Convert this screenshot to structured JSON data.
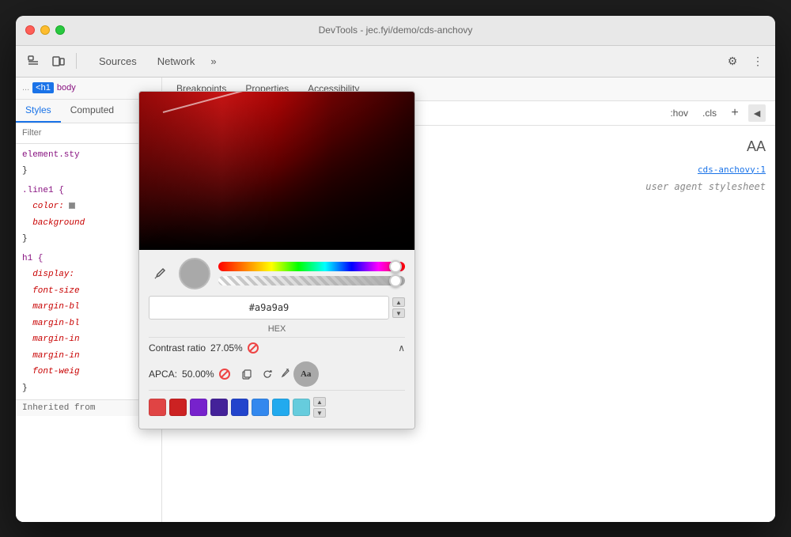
{
  "window": {
    "title": "DevTools - jec.fyi/demo/cds-anchovy",
    "traffic_lights": [
      "close",
      "minimize",
      "maximize"
    ]
  },
  "top_toolbar": {
    "tabs": [
      {
        "label": "Sources",
        "active": false
      },
      {
        "label": "Network",
        "active": false
      }
    ],
    "more_label": "»",
    "settings_icon": "⚙",
    "more_options_icon": "⋮"
  },
  "left_panel": {
    "breadcrumb": {
      "dots": "...",
      "html_tag": "<h1",
      "body_tag": "body"
    },
    "sub_tabs": [
      "Styles",
      "Computed"
    ],
    "filter_placeholder": "Filter",
    "css_rules": [
      {
        "selector": "element.style",
        "brace_open": "{",
        "brace_close": "}"
      },
      {
        "selector": ".line1",
        "brace_open": "{",
        "properties": [
          {
            "name": "color:",
            "value": "",
            "has_swatch": true,
            "swatch_color": "#888"
          },
          {
            "name": "background",
            "value": ""
          }
        ],
        "brace_close": "}"
      },
      {
        "selector": "h1",
        "brace_open": "{",
        "properties": [
          {
            "name": "display:",
            "value": ""
          },
          {
            "name": "font-size",
            "value": ""
          },
          {
            "name": "margin-bl",
            "value": ""
          },
          {
            "name": "margin-bl",
            "value": ""
          },
          {
            "name": "margin-in",
            "value": ""
          },
          {
            "name": "margin-in",
            "value": ""
          },
          {
            "name": "font-weig",
            "value": ""
          }
        ],
        "brace_close": "}"
      }
    ],
    "inherited_from": "Inherited from"
  },
  "color_picker": {
    "hex_value": "#a9a9a9",
    "hex_label": "HEX",
    "contrast_label": "Contrast ratio",
    "contrast_value": "27.05%",
    "apca_label": "APCA:",
    "apca_value": "50.00%",
    "aa_badge": "Aa",
    "swatches": [
      {
        "color": "#e04444",
        "label": "red-swatch"
      },
      {
        "color": "#cc2222",
        "label": "dark-red-swatch"
      },
      {
        "color": "#7722cc",
        "label": "purple-swatch"
      },
      {
        "color": "#442299",
        "label": "dark-purple-swatch"
      },
      {
        "color": "#2244cc",
        "label": "blue-swatch"
      },
      {
        "color": "#3388ee",
        "label": "light-blue-swatch"
      },
      {
        "color": "#22aaee",
        "label": "sky-blue-swatch"
      },
      {
        "color": "#66ccdd",
        "label": "cyan-swatch"
      }
    ]
  },
  "right_panel": {
    "sub_tabs": [
      "Breakpoints",
      "Properties",
      "Accessibility"
    ],
    "toolbar": {
      "hov_label": ":hov",
      "cls_label": ".cls",
      "plus_label": "+",
      "new_rule_label": "◄"
    },
    "aa_large": "AA",
    "source_link": "cds-anchovy:1",
    "user_agent_label": "user agent stylesheet"
  }
}
